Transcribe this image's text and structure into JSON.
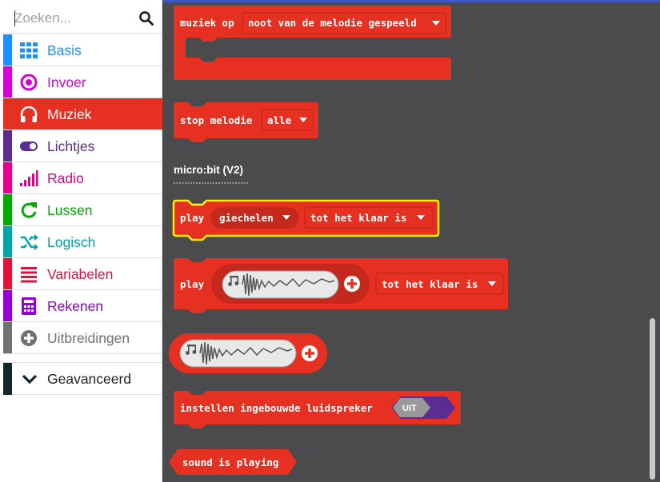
{
  "search": {
    "placeholder": "Zoeken..."
  },
  "categories": [
    {
      "label": "Basis",
      "color": "#1e90ff",
      "icon": "grid-icon"
    },
    {
      "label": "Invoer",
      "color": "#d400d4",
      "icon": "radio-button-icon"
    },
    {
      "label": "Muziek",
      "color": "#e63022",
      "icon": "headphones-icon",
      "active": true
    },
    {
      "label": "Lichtjes",
      "color": "#5c2d91",
      "icon": "toggle-icon"
    },
    {
      "label": "Radio",
      "color": "#e3008c",
      "icon": "signal-bars-icon"
    },
    {
      "label": "Lussen",
      "color": "#00aa00",
      "icon": "refresh-icon"
    },
    {
      "label": "Logisch",
      "color": "#00a4a6",
      "icon": "shuffle-icon"
    },
    {
      "label": "Variabelen",
      "color": "#dc143c",
      "icon": "list-lines-icon"
    },
    {
      "label": "Rekenen",
      "color": "#9400d3",
      "icon": "calculator-icon"
    },
    {
      "label": "Uitbreidingen",
      "color": "#717171",
      "icon": "plus-circle-icon"
    }
  ],
  "advanced": {
    "label": "Geavanceerd",
    "color": "#17262a",
    "icon": "chevron-down-icon"
  },
  "blocks": {
    "music_on": {
      "text": "muziek op",
      "dropdown": "noot van de melodie gespeeld"
    },
    "stop_melody": {
      "text": "stop melodie",
      "dropdown": "alle"
    },
    "section": "micro:bit (V2)",
    "play_giggle": {
      "text": "play",
      "sound": "giechelen",
      "mode": "tot het klaar is"
    },
    "play_sound": {
      "text": "play",
      "mode": "tot het klaar is"
    },
    "set_speaker": {
      "text": "instellen ingebouwde luidspreker",
      "toggle": "UIT"
    },
    "sound_playing": {
      "text": "sound is playing"
    }
  },
  "colors": {
    "music": "#e63022",
    "music_dark": "#c5281c",
    "flyout_bg": "#4b4a4d",
    "highlight": "#fff200",
    "toggle_bg": "#5c2d91",
    "toggle_knob": "#999999"
  }
}
